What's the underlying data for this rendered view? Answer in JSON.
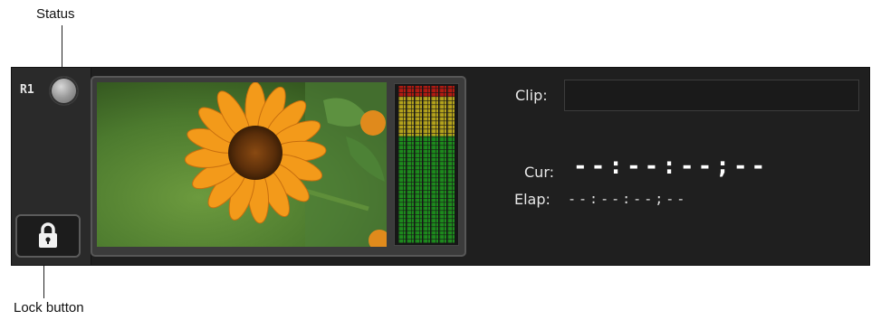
{
  "annotations": {
    "status": "Status",
    "lock_button": "Lock button"
  },
  "channel": {
    "name": "R1"
  },
  "labels": {
    "clip": "Clip:",
    "cur": "Cur:",
    "elap": "Elap:"
  },
  "clip_value": "",
  "timecode": {
    "current": "--:--:--;--",
    "elapsed": "--:--:--;--"
  },
  "icons": {
    "status": "status-led-icon",
    "lock": "padlock-icon"
  },
  "colors": {
    "meter_red": "#b01a12",
    "meter_yellow": "#b3a21c",
    "meter_green": "#1d8a1d",
    "status_led": "#9a9a9a"
  }
}
